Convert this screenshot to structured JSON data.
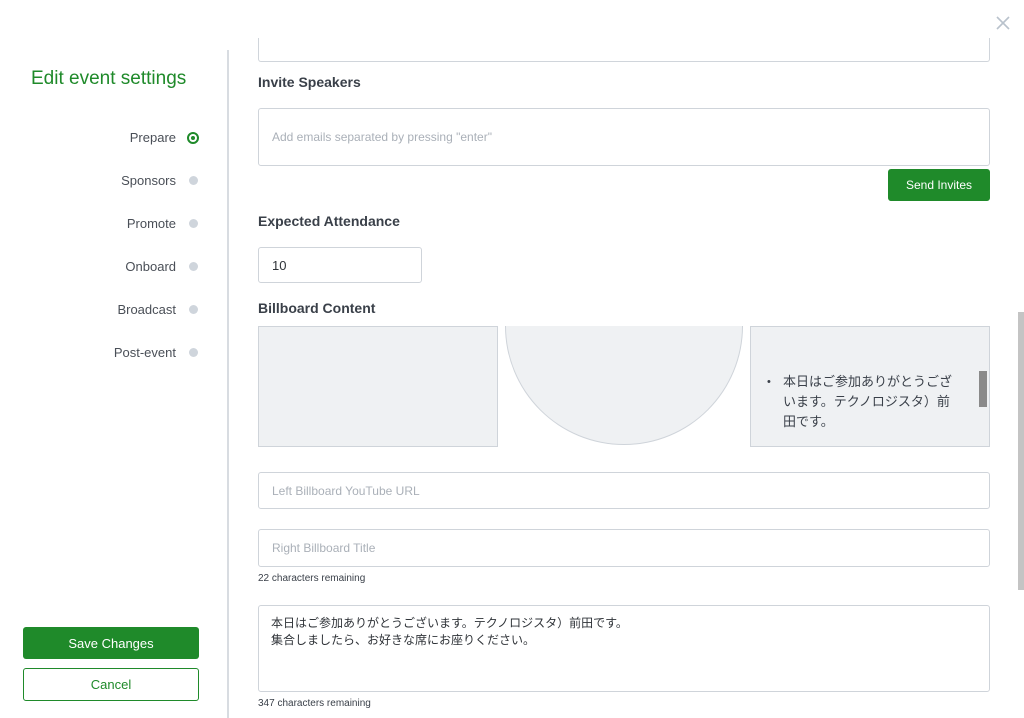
{
  "sidebar": {
    "title": "Edit event settings",
    "steps": [
      {
        "label": "Prepare",
        "active": true
      },
      {
        "label": "Sponsors",
        "active": false
      },
      {
        "label": "Promote",
        "active": false
      },
      {
        "label": "Onboard",
        "active": false
      },
      {
        "label": "Broadcast",
        "active": false
      },
      {
        "label": "Post-event",
        "active": false
      }
    ],
    "save_label": "Save Changes",
    "cancel_label": "Cancel"
  },
  "invite": {
    "label": "Invite Speakers",
    "placeholder": "Add emails separated by pressing \"enter\"",
    "button_label": "Send Invites"
  },
  "attendance": {
    "label": "Expected Attendance",
    "value": "10"
  },
  "billboard": {
    "label": "Billboard Content",
    "right_preview_text": "本日はご参加ありがとうございます。テクノロジスタ）前田です。",
    "left_url_placeholder": "Left Billboard YouTube URL",
    "right_title_placeholder": "Right Billboard Title",
    "title_remaining": "22 characters remaining",
    "message_text": "本日はご参加ありがとうございます。テクノロジスタ）前田です。\n集合しましたら、お好きな席にお座りください。",
    "message_remaining": "347 characters remaining"
  },
  "colors": {
    "accent": "#1f8a2a",
    "border": "#cfd4da",
    "preview_bg": "#eff1f3"
  }
}
